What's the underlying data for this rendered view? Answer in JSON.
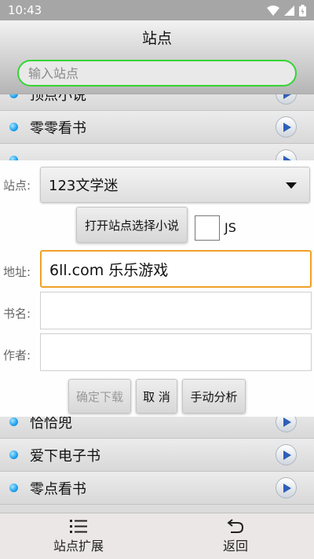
{
  "status_bar": {
    "time": "10:43",
    "icons": [
      "wifi-icon",
      "signal-icon",
      "battery-icon"
    ]
  },
  "header": {
    "title": "站点"
  },
  "search": {
    "placeholder": "输入站点"
  },
  "sites_top": [
    {
      "label": "顶点小说"
    },
    {
      "label": "零零看书"
    }
  ],
  "sites_bottom": [
    {
      "label": "恰恰兜"
    },
    {
      "label": "爱下电子书"
    },
    {
      "label": "零点看书"
    }
  ],
  "dialog": {
    "site_label": "站点:",
    "site_selected": "123文学迷",
    "open_site_button": "打开站点选择小说",
    "js_label": "JS",
    "js_checked": false,
    "url_label": "地址:",
    "url_value": "6ll.com 乐乐游戏",
    "book_label": "书名:",
    "book_value": "",
    "author_label": "作者:",
    "author_value": "",
    "confirm_button": "确定下载",
    "cancel_button": "取 消",
    "manual_button": "手动分析"
  },
  "bottom_nav": [
    {
      "label": "站点扩展",
      "icon": "list-icon"
    },
    {
      "label": "返回",
      "icon": "back-arrow-icon"
    }
  ],
  "colors": {
    "search_border": "#35d535",
    "active_field_border": "#f0a028",
    "dot": "#1e9fee"
  }
}
